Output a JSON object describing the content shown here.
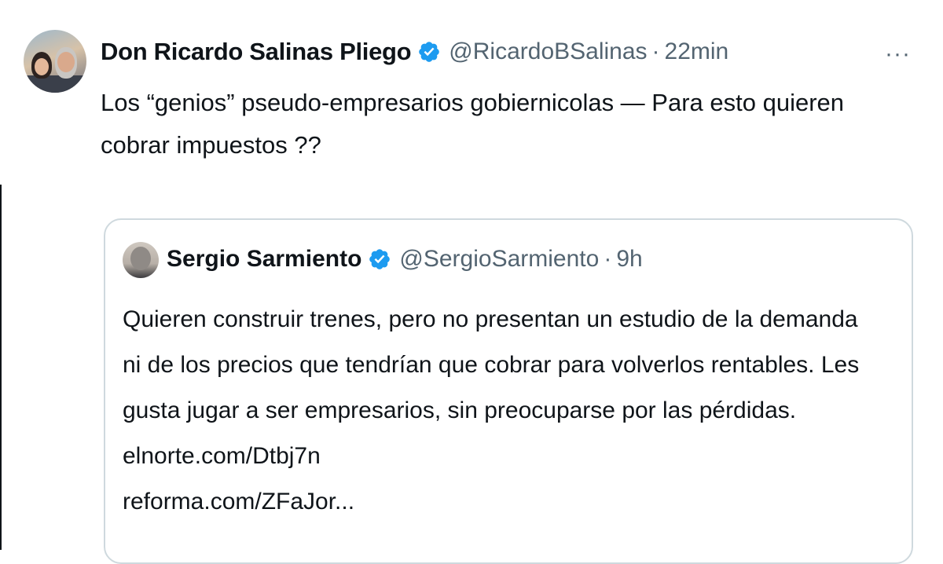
{
  "tweet": {
    "display_name": "Don Ricardo Salinas Pliego",
    "handle": "@RicardoBSalinas",
    "separator": "·",
    "time": "22min",
    "more": "···",
    "text_line1": "Los “genios” pseudo-empresarios gobiernicolas — Para esto quieren",
    "text_line2": "cobrar impuestos ??"
  },
  "quoted_tweet": {
    "display_name": "Sergio Sarmiento",
    "handle": "@SergioSarmiento",
    "separator": "·",
    "time": "9h",
    "lines": [
      "Quieren construir trenes, pero no presentan un estudio de la demanda",
      "ni de los precios que tendrían que cobrar para volverlos rentables. Les",
      "gusta jugar a ser empresarios, sin preocuparse por las pérdidas.",
      "elnorte.com/Dtbj7n",
      "reforma.com/ZFaJor..."
    ]
  },
  "colors": {
    "verified_badge": "#1d9bf0",
    "secondary_text": "#536471",
    "primary_text": "#0f1419",
    "quote_border": "#cfd9de"
  },
  "icons": [
    "verified-badge-icon",
    "more-options-icon"
  ]
}
